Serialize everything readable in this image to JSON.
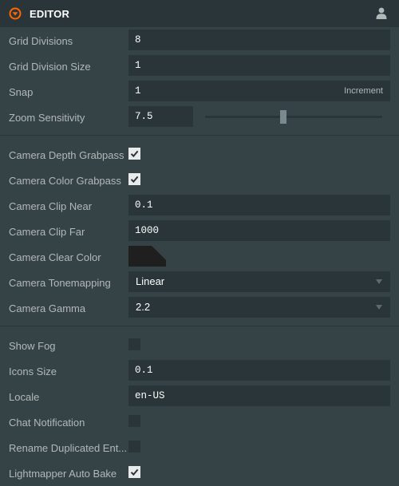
{
  "header": {
    "title": "EDITOR"
  },
  "grid": {
    "divisions": {
      "label": "Grid Divisions",
      "value": "8"
    },
    "division_size": {
      "label": "Grid Division Size",
      "value": "1"
    },
    "snap": {
      "label": "Snap",
      "value": "1",
      "suffix": "Increment"
    },
    "zoom": {
      "label": "Zoom Sensitivity",
      "value": "7.5"
    }
  },
  "camera": {
    "depth_grabpass": {
      "label": "Camera Depth Grabpass",
      "checked": true
    },
    "color_grabpass": {
      "label": "Camera Color Grabpass",
      "checked": true
    },
    "clip_near": {
      "label": "Camera Clip Near",
      "value": "0.1"
    },
    "clip_far": {
      "label": "Camera Clip Far",
      "value": "1000"
    },
    "clear_color": {
      "label": "Camera Clear Color",
      "color": "#1f1f1f"
    },
    "tonemapping": {
      "label": "Camera Tonemapping",
      "value": "Linear"
    },
    "gamma": {
      "label": "Camera Gamma",
      "value": "2.2"
    }
  },
  "misc": {
    "show_fog": {
      "label": "Show Fog",
      "checked": false
    },
    "icons_size": {
      "label": "Icons Size",
      "value": "0.1"
    },
    "locale": {
      "label": "Locale",
      "value": "en-US"
    },
    "chat_notification": {
      "label": "Chat Notification",
      "checked": false
    },
    "rename_duplicated": {
      "label": "Rename Duplicated Ent...",
      "checked": false
    },
    "lightmapper_auto_bake": {
      "label": "Lightmapper Auto Bake",
      "checked": true
    }
  },
  "icons": {
    "collapse": "collapse-circle-icon",
    "user": "user-icon",
    "checkmark": "checkmark-icon"
  },
  "colors": {
    "accent": "#f60",
    "panel_bg": "#364346",
    "field_bg": "#293538",
    "text": "#b1b8ba"
  }
}
